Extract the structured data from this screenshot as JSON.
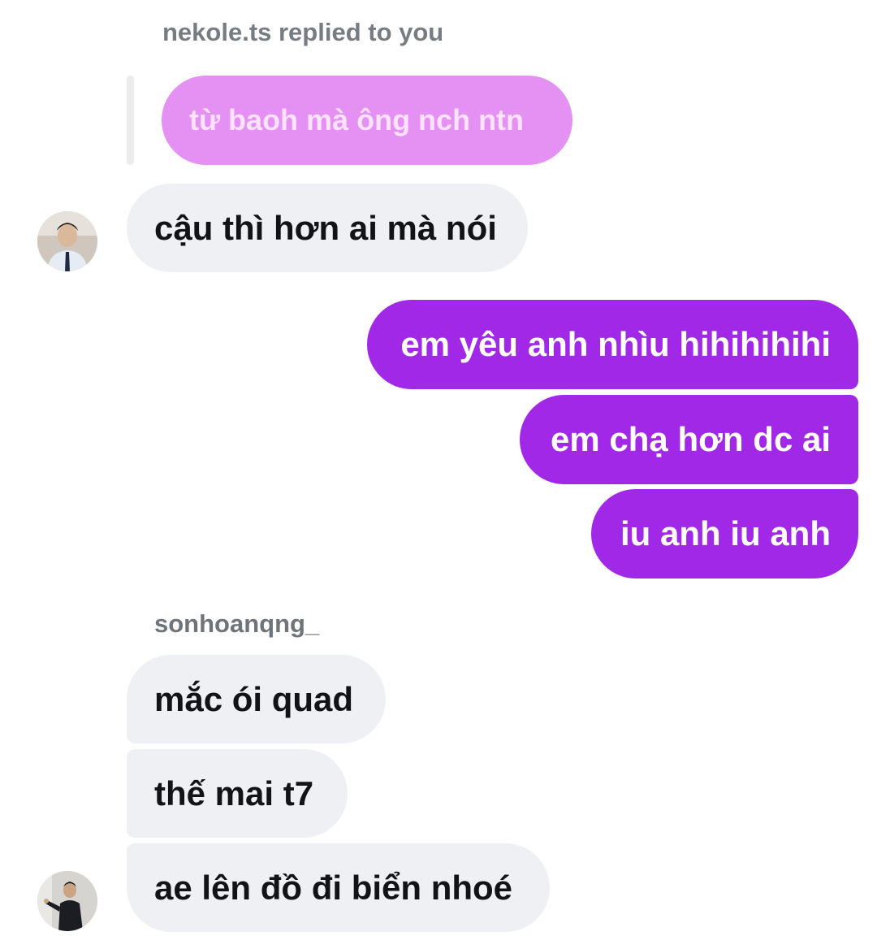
{
  "reply_context": {
    "caption": "nekole.ts replied to you",
    "quoted_text": "từ baoh mà ông nch ntn"
  },
  "messages": {
    "incoming_1": "cậu thì hơn ai mà nói",
    "outgoing_1": "em yêu anh nhìu hihihihihi",
    "outgoing_2": "em chạ hơn dc ai",
    "outgoing_3": "iu anh iu anh",
    "incoming_2": "mắc ói quad",
    "incoming_3": "thế mai t7",
    "incoming_4": "ae lên đồ đi biển nhoé"
  },
  "sender_name": "sonhoanqng_",
  "colors": {
    "outgoing_bubble": "#a128e6",
    "quoted_bubble": "#e590f3",
    "incoming_bubble": "#eff0f3",
    "caption_text": "#777c83"
  }
}
